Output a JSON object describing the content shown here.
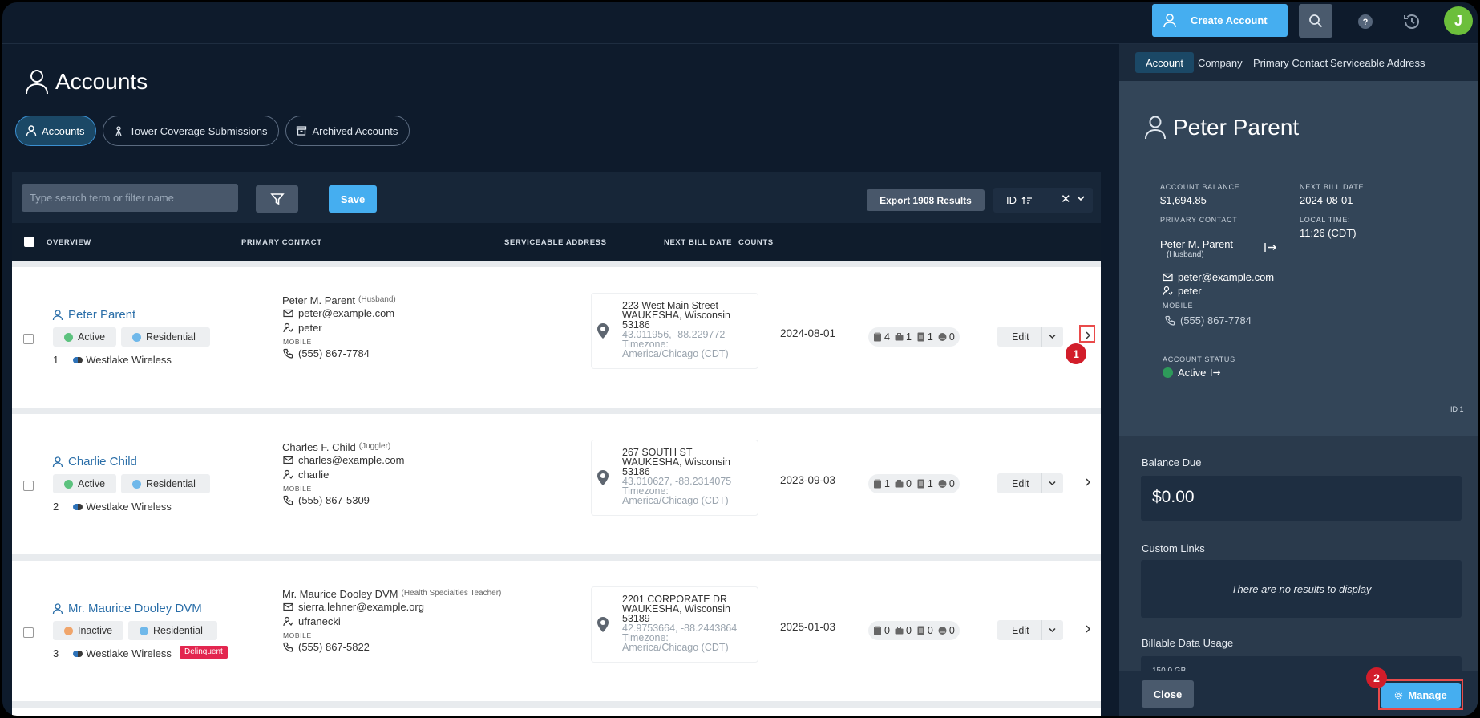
{
  "header": {
    "create_account_label": "Create Account",
    "avatar_initial": "J",
    "help_label": "?"
  },
  "page": {
    "title": "Accounts",
    "tabs": [
      {
        "label": "Accounts",
        "icon": "user-icon",
        "active": true
      },
      {
        "label": "Tower Coverage Submissions",
        "icon": "tower-icon",
        "active": false
      },
      {
        "label": "Archived Accounts",
        "icon": "archive-icon",
        "active": false
      }
    ]
  },
  "toolbar": {
    "search_placeholder": "Type search term or filter name",
    "save_label": "Save",
    "export_label": "Export 1908 Results",
    "sort_label": "ID",
    "clear_label": "✕"
  },
  "table": {
    "columns": [
      "OVERVIEW",
      "PRIMARY CONTACT",
      "SERVICEABLE ADDRESS",
      "NEXT BILL DATE",
      "COUNTS"
    ],
    "rows": [
      {
        "name": "Peter Parent",
        "status": "Active",
        "status_color": "#5cc27e",
        "type": "Residential",
        "type_color": "#6fb8ea",
        "index": "1",
        "company": "Westlake Wireless",
        "delinquent": "",
        "contact_name": "Peter M. Parent",
        "contact_role": "(Husband)",
        "email": "peter@example.com",
        "username": "peter",
        "mobile_label": "MOBILE",
        "phone": "(555) 867-7784",
        "address_line1": "223 West Main Street",
        "address_line2": "WAUKESHA, Wisconsin",
        "address_zip": "53186",
        "geo": "43.011956, -88.229772",
        "timezone_label": "Timezone:",
        "timezone": "America/Chicago (CDT)",
        "next_bill_date": "2024-08-01",
        "counts": [
          "4",
          "1",
          "1",
          "0"
        ],
        "edit_label": "Edit"
      },
      {
        "name": "Charlie Child",
        "status": "Active",
        "status_color": "#5cc27e",
        "type": "Residential",
        "type_color": "#6fb8ea",
        "index": "2",
        "company": "Westlake Wireless",
        "delinquent": "",
        "contact_name": "Charles F. Child",
        "contact_role": "(Juggler)",
        "email": "charles@example.com",
        "username": "charlie",
        "mobile_label": "MOBILE",
        "phone": "(555) 867-5309",
        "address_line1": "267 SOUTH ST",
        "address_line2": "WAUKESHA, Wisconsin",
        "address_zip": "53186",
        "geo": "43.010627, -88.2314075",
        "timezone_label": "Timezone:",
        "timezone": "America/Chicago (CDT)",
        "next_bill_date": "2023-09-03",
        "counts": [
          "1",
          "0",
          "1",
          "0"
        ],
        "edit_label": "Edit"
      },
      {
        "name": "Mr. Maurice Dooley DVM",
        "status": "Inactive",
        "status_color": "#f0a56b",
        "type": "Residential",
        "type_color": "#6fb8ea",
        "index": "3",
        "company": "Westlake Wireless",
        "delinquent": "Delinquent",
        "contact_name": "Mr. Maurice Dooley DVM",
        "contact_role": "(Health Specialties Teacher)",
        "email": "sierra.lehner@example.org",
        "username": "ufranecki",
        "mobile_label": "MOBILE",
        "phone": "(555) 867-5822",
        "address_line1": "2201 CORPORATE DR",
        "address_line2": "WAUKESHA, Wisconsin",
        "address_zip": "53189",
        "geo": "42.9753664, -88.2443864",
        "timezone_label": "Timezone:",
        "timezone": "America/Chicago (CDT)",
        "next_bill_date": "2025-01-03",
        "counts": [
          "0",
          "0",
          "0",
          "0"
        ],
        "edit_label": "Edit"
      }
    ]
  },
  "annotations": {
    "first": "1",
    "second": "2"
  },
  "side": {
    "tabs": [
      "Account",
      "Company",
      "Primary Contact",
      "Serviceable Address"
    ],
    "name": "Peter Parent",
    "balance_label": "ACCOUNT BALANCE",
    "balance": "$1,694.85",
    "next_bill_label": "NEXT BILL DATE",
    "next_bill": "2024-08-01",
    "primary_contact_label": "PRIMARY CONTACT",
    "contact_name": "Peter M. Parent",
    "contact_role": "(Husband)",
    "local_time_label": "LOCAL TIME:",
    "local_time": "11:26 (CDT)",
    "email": "peter@example.com",
    "username": "peter",
    "mobile_label": "MOBILE",
    "phone": "(555) 867-7784",
    "status_label": "ACCOUNT STATUS",
    "status": "Active",
    "status_color": "#2e9a5a",
    "id_label": "ID 1",
    "balance_due_label": "Balance Due",
    "balance_due": "$0.00",
    "custom_links_label": "Custom Links",
    "custom_links_empty": "There are no results to display",
    "usage_label": "Billable Data Usage",
    "usage_partial": "150.0 GB",
    "close_label": "Close",
    "manage_label": "Manage"
  }
}
